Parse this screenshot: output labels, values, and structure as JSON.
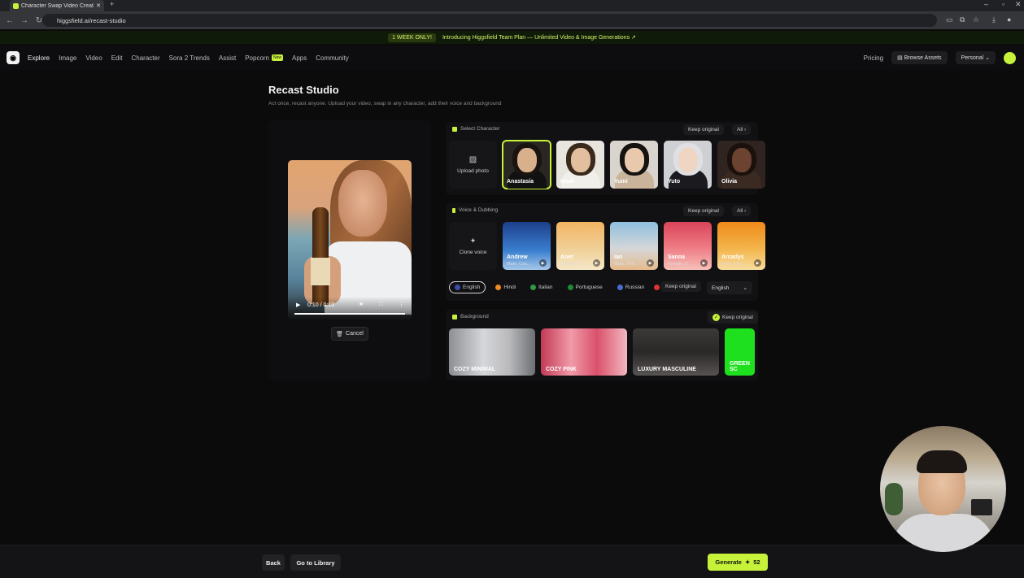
{
  "browser": {
    "tab_title": "Character Swap Video Creatio",
    "url": "higgsfield.ai/recast-studio"
  },
  "promo": {
    "pill": "1 WEEK ONLY!",
    "text": "Introducing Higgsfield Team Plan — Unlimited Video & Image Generations ↗"
  },
  "nav": {
    "items": [
      "Explore",
      "Image",
      "Video",
      "Edit",
      "Character",
      "Sora 2 Trends",
      "Assist",
      "Popcorn",
      "Apps",
      "Community"
    ],
    "new_badge": "New",
    "pricing": "Pricing",
    "browse_assets": "Browse Assets",
    "workspace": "Personal"
  },
  "page": {
    "title": "Recast Studio",
    "subtitle": "Act once, recast anyone. Upload your video, swap in any character, add their voice and background"
  },
  "video": {
    "time": "0:10 / 0:10",
    "cancel": "Cancel"
  },
  "character": {
    "header": "Select Character",
    "keep_original": "Keep original",
    "all": "All",
    "upload": "Upload photo",
    "items": [
      {
        "name": "Anastasia",
        "skin": "#d9b08c",
        "hair": "#1a1410",
        "bg": "#2a2622",
        "clothes": "#111111"
      },
      {
        "name": "Noah",
        "skin": "#e2bf9e",
        "hair": "#3a2a1c",
        "bg": "#e8e4de",
        "clothes": "#f0efea"
      },
      {
        "name": "Yumi",
        "skin": "#e8c9ad",
        "hair": "#151210",
        "bg": "#d9d4cd",
        "clothes": "#c9b39a"
      },
      {
        "name": "Yuto",
        "skin": "#eed6c3",
        "hair": "#dfe0e4",
        "bg": "#cfd0d4",
        "clothes": "#1b1b1f"
      },
      {
        "name": "Olivia",
        "skin": "#6b4330",
        "hair": "#1a110c",
        "bg": "#2f2420",
        "clothes": "#3a2a22"
      }
    ]
  },
  "voice": {
    "header": "Voice & Dubbing",
    "keep_original": "Keep original",
    "all": "All",
    "clone": "Clone voice",
    "items": [
      {
        "name": "Andrew",
        "desc": "Male, Cas...",
        "bg": "linear-gradient(180deg,#1d3f8a,#3a7fd0 60%,#a7c8e8)"
      },
      {
        "name": "Anet",
        "desc": "Female, Fl...",
        "bg": "linear-gradient(180deg,#f2b463,#f0d29a 60%,#f6e7c8)"
      },
      {
        "name": "Ian",
        "desc": "Male, Refl...",
        "bg": "linear-gradient(180deg,#8fc0df,#d4d6d8 55%,#e6bb8c)"
      },
      {
        "name": "Sanna",
        "desc": "Female, C...",
        "bg": "linear-gradient(180deg,#d9445a,#ef7d86 55%,#f6c0b8)"
      },
      {
        "name": "Arcadys",
        "desc": "Male, Smo...",
        "bg": "linear-gradient(180deg,#f08a1a,#f3b44a 55%,#f7dca0)"
      }
    ],
    "languages": [
      {
        "name": "English",
        "color": "#3b4fa8",
        "selected": true
      },
      {
        "name": "Hindi",
        "color": "#f08a24",
        "selected": false
      },
      {
        "name": "Italian",
        "color": "#2e9a44",
        "selected": false
      },
      {
        "name": "Portuguese",
        "color": "#1c8a3a",
        "selected": false
      },
      {
        "name": "Russian",
        "color": "#4a6cd0",
        "selected": false
      }
    ],
    "lang_keep_original": "Keep original",
    "dropdown_value": "English"
  },
  "background": {
    "header": "Background",
    "keep_original": "Keep original",
    "items": [
      {
        "name": "COZY MINIMAL",
        "bg": "linear-gradient(90deg,#8e8f93,#d6d7da 40%,#b9b9bc 70%,#6e6f72)"
      },
      {
        "name": "COZY PINK",
        "bg": "linear-gradient(90deg,#c23a54,#f19aa8 35%,#d9516b 65%,#f3b7c0)"
      },
      {
        "name": "LUXURY MASCULINE",
        "bg": "linear-gradient(180deg,#3c3a39,#2a2826 50%,#575352)"
      },
      {
        "name": "GREEN SC",
        "bg": "#1fe01f"
      }
    ]
  },
  "footer": {
    "back": "Back",
    "library": "Go to Library",
    "generate": "Generate",
    "credits": "52"
  },
  "colors": {
    "accent": "#c7f23a",
    "background": "#0b0b0c"
  }
}
